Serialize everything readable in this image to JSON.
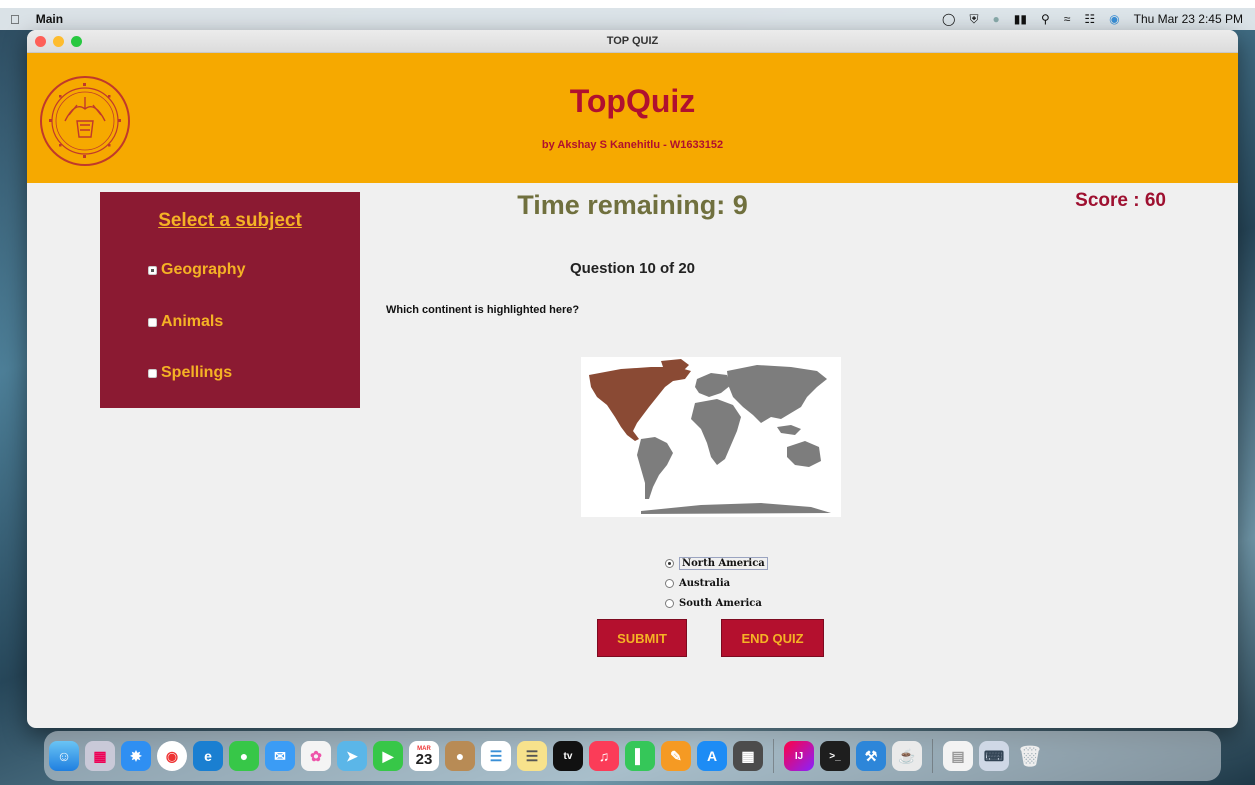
{
  "menubar": {
    "app_name": "Main",
    "clock": "Thu Mar 23  2:45 PM"
  },
  "window": {
    "title": "TOP QUIZ"
  },
  "header": {
    "app_title": "TopQuiz",
    "byline": "by Akshay S Kanehitlu - W1633152",
    "logo": "santa-clara-university-seal"
  },
  "sidebar": {
    "heading": "Select a subject",
    "subjects": [
      {
        "label": "Geography",
        "checked": true
      },
      {
        "label": "Animals",
        "checked": false
      },
      {
        "label": "Spellings",
        "checked": false
      }
    ]
  },
  "quiz": {
    "timer": "Time remaining: 9",
    "score": "Score : 60",
    "question_counter": "Question 10 of 20",
    "question": "Which continent is highlighted here?",
    "options": [
      {
        "label": "North America",
        "selected": true
      },
      {
        "label": "Australia",
        "selected": false
      },
      {
        "label": "South America",
        "selected": false
      }
    ],
    "submit_label": "SUBMIT",
    "end_label": "END QUIZ"
  },
  "colors": {
    "header_bg": "#f6a900",
    "brand_red": "#b0102f",
    "sidebar_bg": "#8b1a32",
    "accent_gold": "#f5b225",
    "highlight_continent": "#8a4a34"
  },
  "dock": {
    "calendar_month": "MAR",
    "calendar_day": "23",
    "tv_label": "tv",
    "intellij_label": "IJ"
  }
}
